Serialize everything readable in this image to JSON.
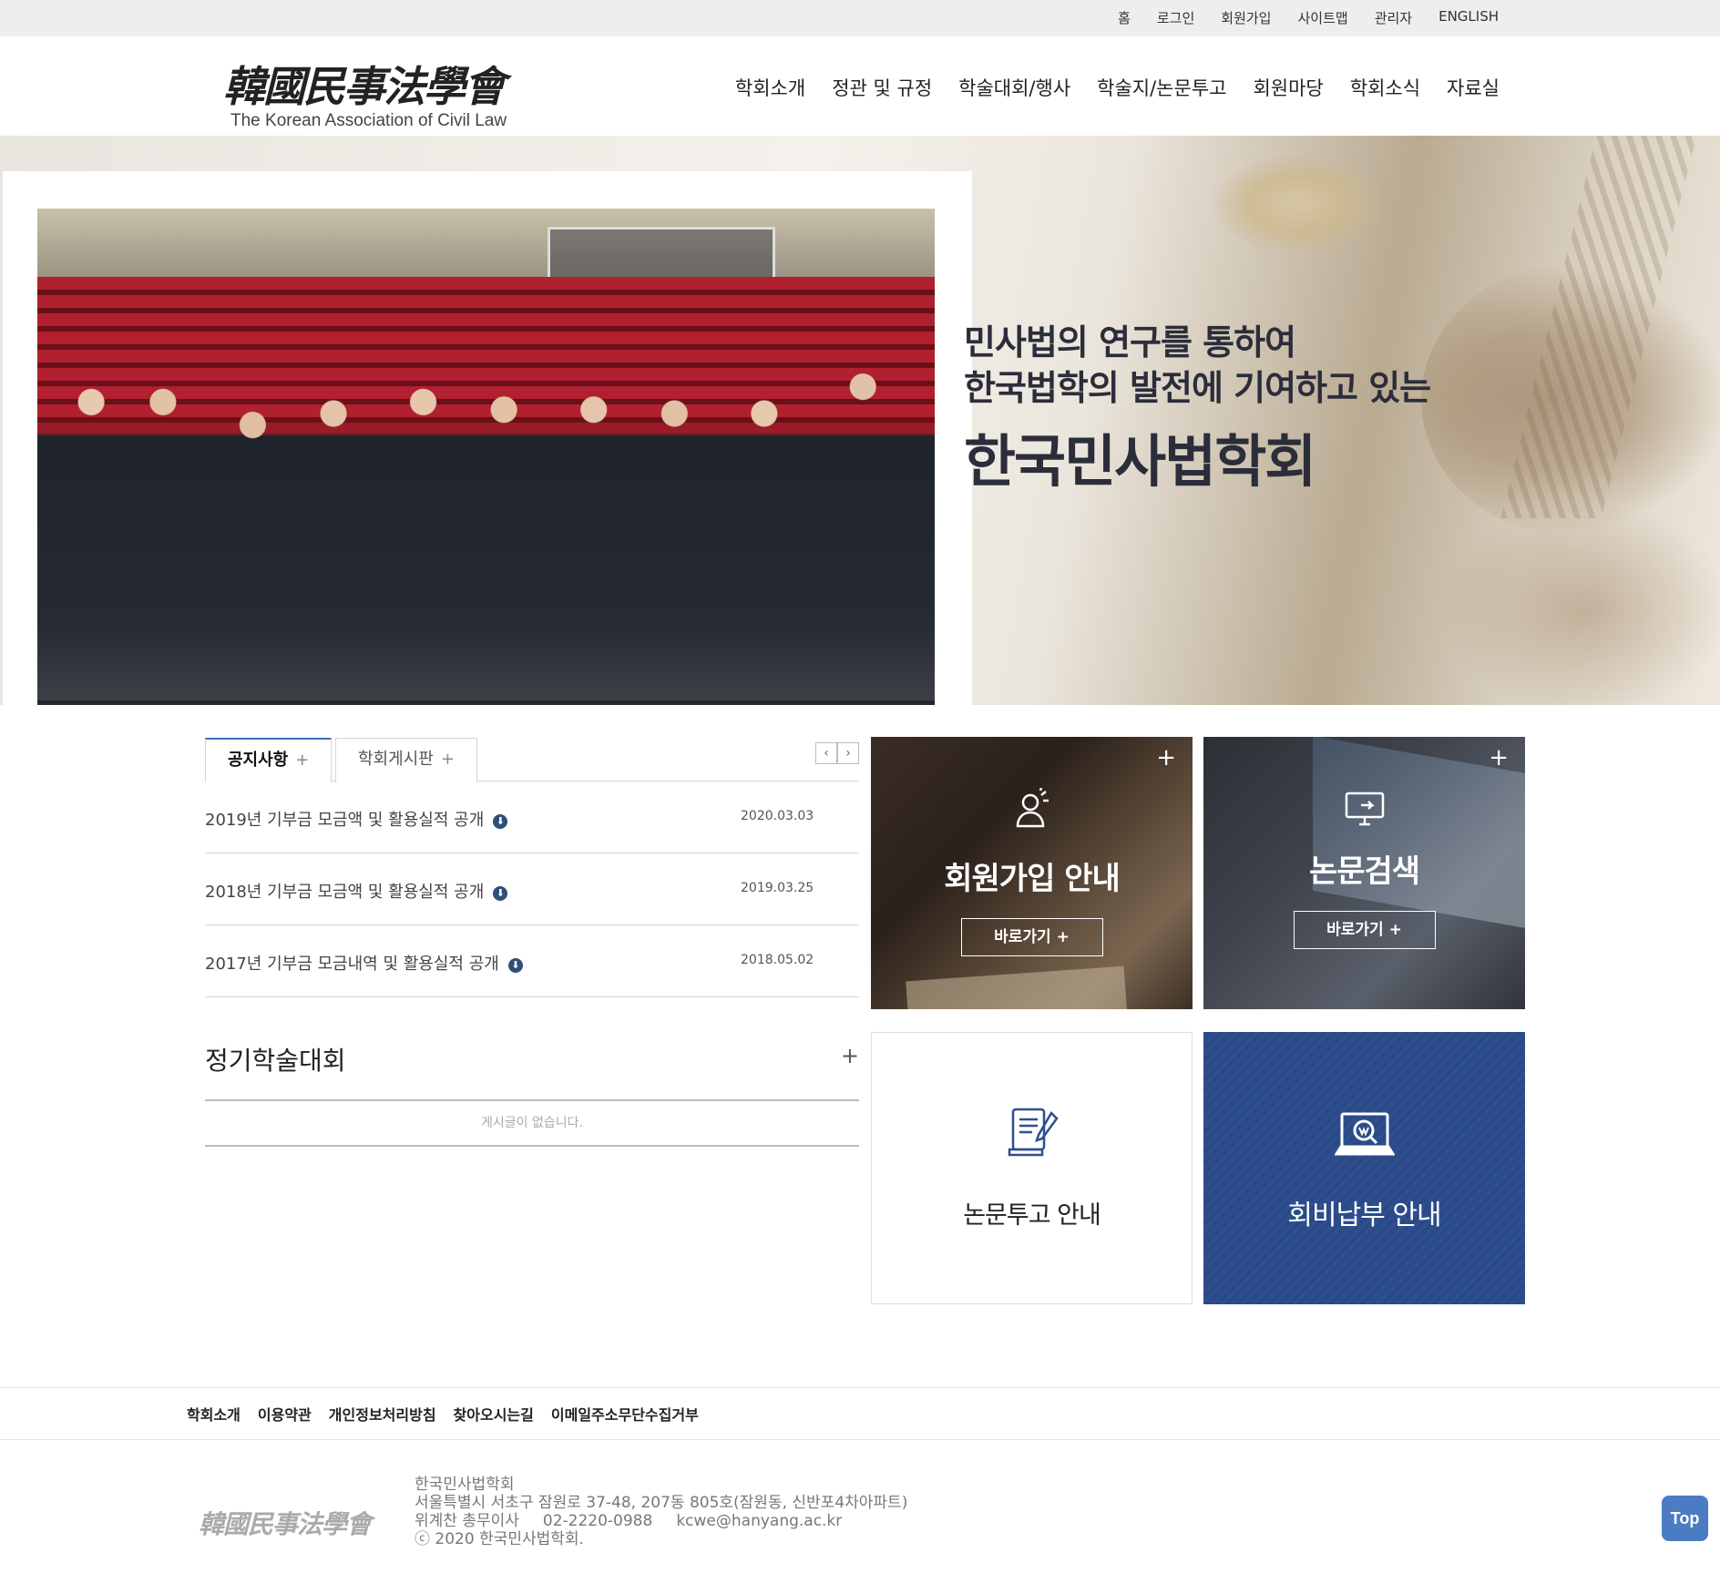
{
  "utility_nav": [
    "홈",
    "로그인",
    "회원가입",
    "사이트맵",
    "관리자",
    "ENGLISH"
  ],
  "logo": {
    "hanja": "韓國民事法學會",
    "english": "The Korean Association of Civil Law"
  },
  "main_nav": [
    "학회소개",
    "정관 및 규정",
    "학술대회/행사",
    "학술지/논문투고",
    "회원마당",
    "학회소식",
    "자료실"
  ],
  "hero": {
    "line1": "민사법의 연구를 통하여",
    "line2": "한국법학의 발전에 기여하고 있는",
    "line3": "한국민사법학회"
  },
  "board": {
    "tabs": [
      {
        "label": "공지사항",
        "plus": "+"
      },
      {
        "label": "학회게시판",
        "plus": "+"
      }
    ],
    "posts": [
      {
        "title": "2019년 기부금 모금액 및 활용실적 공개",
        "date": "2020.03.03"
      },
      {
        "title": "2018년 기부금 모금액 및 활용실적 공개",
        "date": "2019.03.25"
      },
      {
        "title": "2017년 기부금 모금내역 및 활용실적 공개",
        "date": "2018.05.02"
      }
    ]
  },
  "conference": {
    "title": "정기학술대회",
    "plus": "+",
    "empty": "게시글이 없습니다."
  },
  "quick": {
    "membership": {
      "title": "회원가입 안내",
      "button": "바로가기 +",
      "plus": "+",
      "icon": "user-icon"
    },
    "search": {
      "title": "논문검색",
      "button": "바로가기 +",
      "plus": "+",
      "icon": "monitor-icon"
    },
    "submission": {
      "title": "논문투고 안내",
      "icon": "document-icon"
    },
    "fee": {
      "title": "회비납부 안내",
      "icon": "search-won-icon"
    }
  },
  "footer_nav": [
    "학회소개",
    "이용약관",
    "개인정보처리방침",
    "찾아오시는길",
    "이메일주소무단수집거부"
  ],
  "footer": {
    "logo": "韓國民事法學會",
    "org": "한국민사법학회",
    "address": "서울특별시 서초구 잠원로 37-48, 207동 805호(잠원동, 신반포4차아파트)",
    "contact_name": "위계찬 총무이사",
    "phone": "02-2220-0988",
    "email": "kcwe@hanyang.ac.kr",
    "copyright": "ⓒ 2020 한국민사법학회."
  },
  "top_button": "Top",
  "colors": {
    "accent": "#2d4f8e",
    "top_button": "#4b7cc3",
    "tab_active": "#3a6fb5"
  }
}
